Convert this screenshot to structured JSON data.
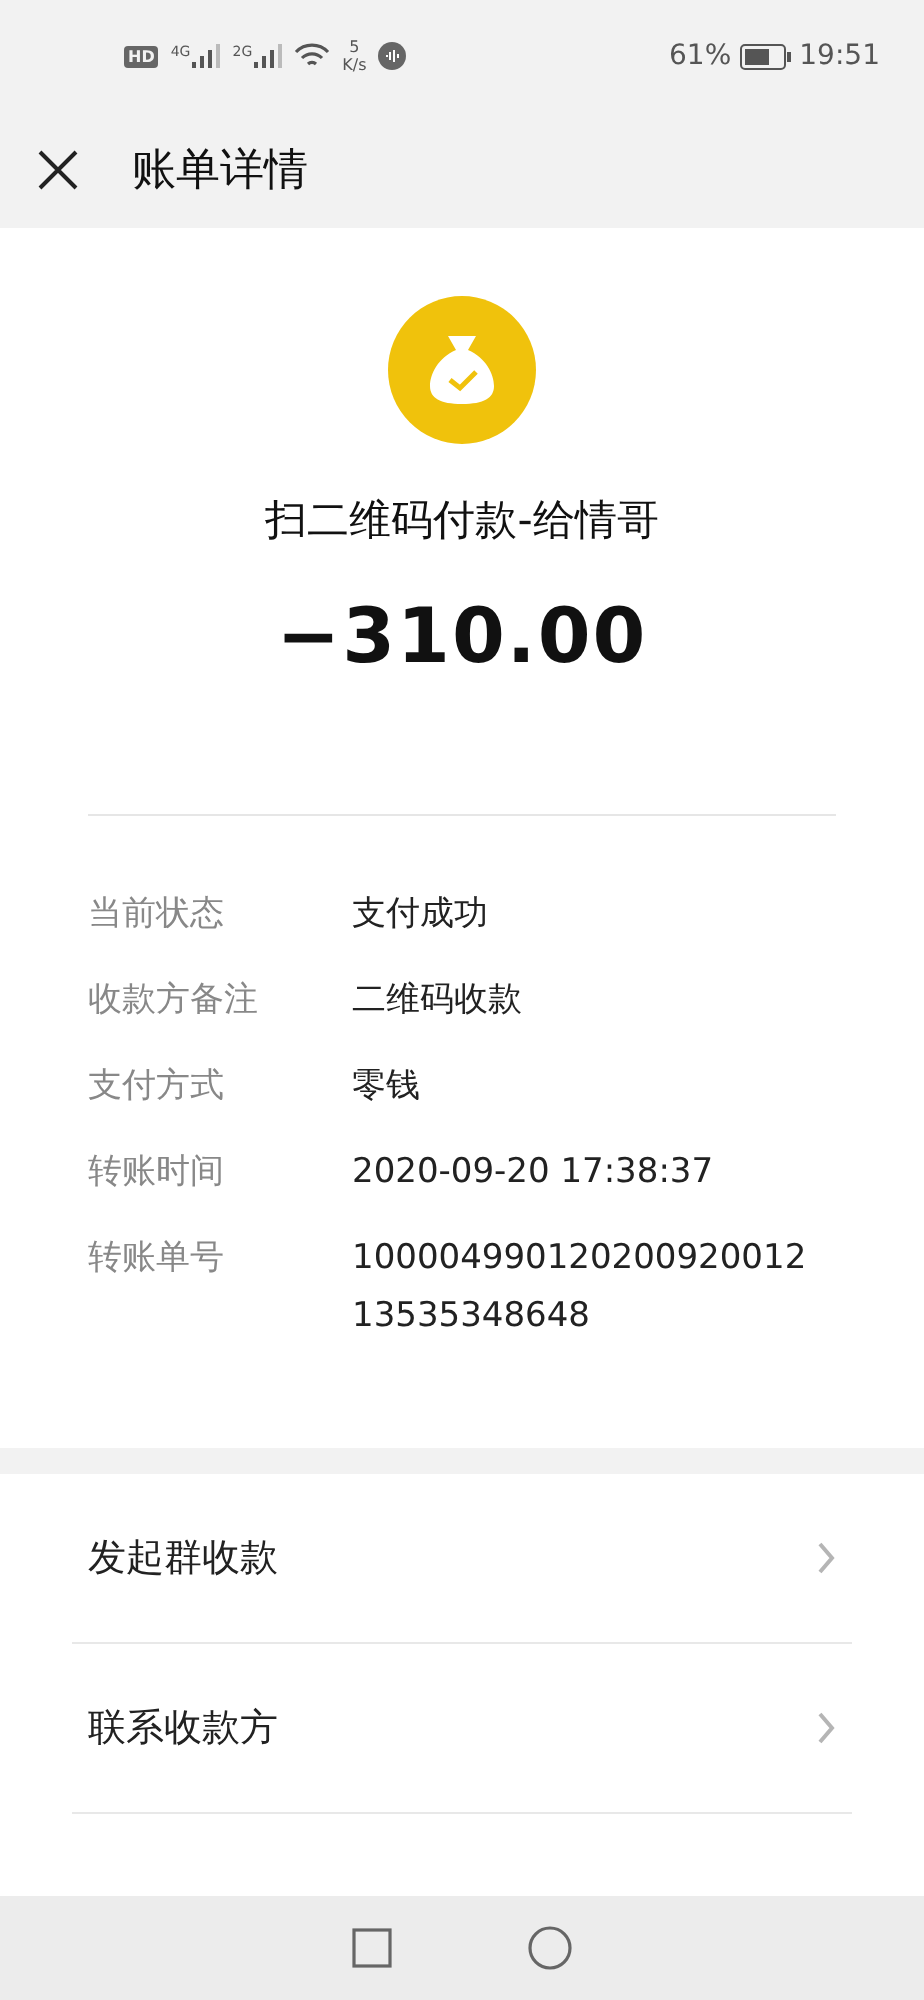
{
  "status_bar": {
    "hd": "HD",
    "sim_1": "4G",
    "sim_2": "2G",
    "speed_value": "5",
    "speed_unit": "K/s",
    "battery": "61%",
    "time": "19:51"
  },
  "header": {
    "title": "账单详情"
  },
  "summary": {
    "title": "扫二维码付款-给情哥",
    "amount": "−310.00"
  },
  "details": [
    {
      "label": "当前状态",
      "value": "支付成功"
    },
    {
      "label": "收款方备注",
      "value": "二维码收款"
    },
    {
      "label": "支付方式",
      "value": "零钱"
    },
    {
      "label": "转账时间",
      "value": "2020-09-20 17:38:37"
    },
    {
      "label": "转账单号",
      "value": "10000499012020092001213535348648"
    }
  ],
  "actions": [
    {
      "label": "发起群收款"
    },
    {
      "label": "联系收款方"
    }
  ]
}
